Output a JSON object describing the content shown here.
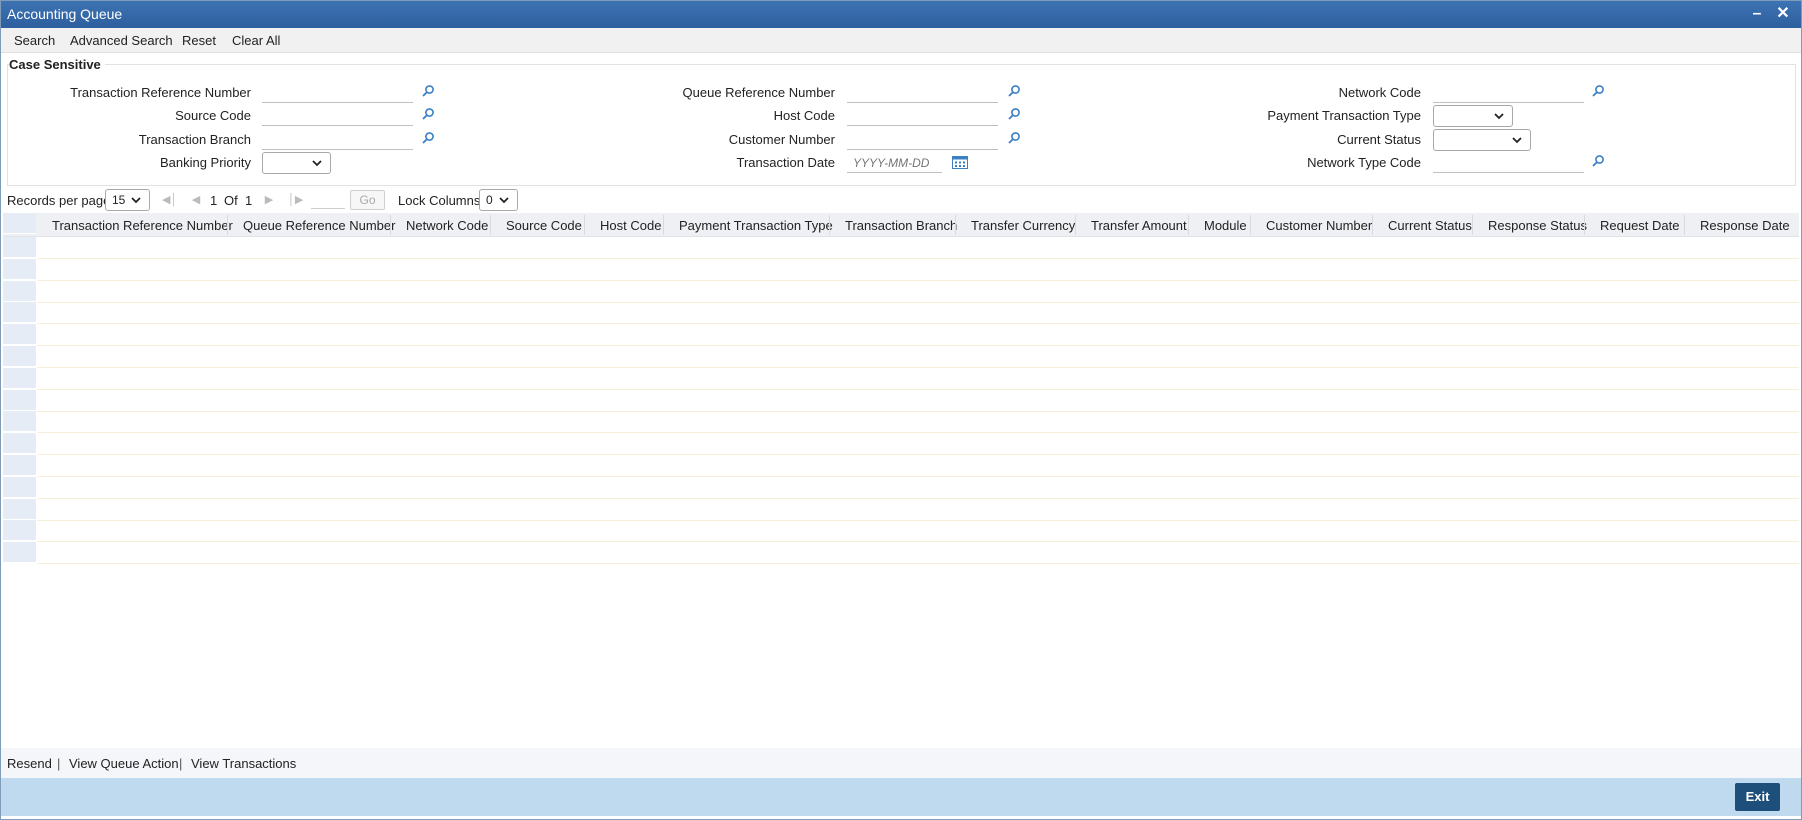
{
  "window": {
    "title": "Accounting Queue",
    "minimize_glyph": "–",
    "close_glyph": "✕"
  },
  "toolbar": {
    "search": "Search",
    "advanced_search": "Advanced Search",
    "reset": "Reset",
    "clear_all": "Clear All"
  },
  "criteria": {
    "legend": "Case Sensitive",
    "fields": {
      "txn_ref": "Transaction Reference Number",
      "source_code": "Source Code",
      "txn_branch": "Transaction Branch",
      "banking_priority": "Banking Priority",
      "queue_ref": "Queue Reference Number",
      "host_code": "Host Code",
      "customer_number": "Customer Number",
      "txn_date": "Transaction Date",
      "network_code": "Network Code",
      "payment_txn_type": "Payment Transaction Type",
      "current_status": "Current Status",
      "network_type_code": "Network Type Code"
    },
    "date_placeholder": "YYYY-MM-DD"
  },
  "pager": {
    "records_label": "Records per page",
    "records_value": "15",
    "page_current": "1",
    "of_label": "Of",
    "page_total": "1",
    "go_label": "Go",
    "lock_label": "Lock Columns",
    "lock_value": "0"
  },
  "grid": {
    "columns": [
      "Transaction Reference Number",
      "Queue Reference Number",
      "Network Code",
      "Source Code",
      "Host Code",
      "Payment Transaction Type",
      "Transaction Branch",
      "Transfer Currency",
      "Transfer Amount",
      "Module",
      "Customer Number",
      "Current Status",
      "Response Status",
      "Request Date",
      "Response Date"
    ],
    "row_count": 15
  },
  "footer": {
    "resend": "Resend",
    "view_queue_action": "View Queue Action",
    "view_transactions": "View Transactions",
    "separator": "|",
    "exit": "Exit"
  },
  "colors": {
    "title_bar": "#2e5f9e",
    "footer_bar": "#bfd9ee",
    "exit_button": "#1d4f7a",
    "lov_icon": "#3b7fc4"
  },
  "icons": {
    "lov": "search-magnifier-icon",
    "calendar": "calendar-icon",
    "dropdown": "chevron-down-icon"
  }
}
